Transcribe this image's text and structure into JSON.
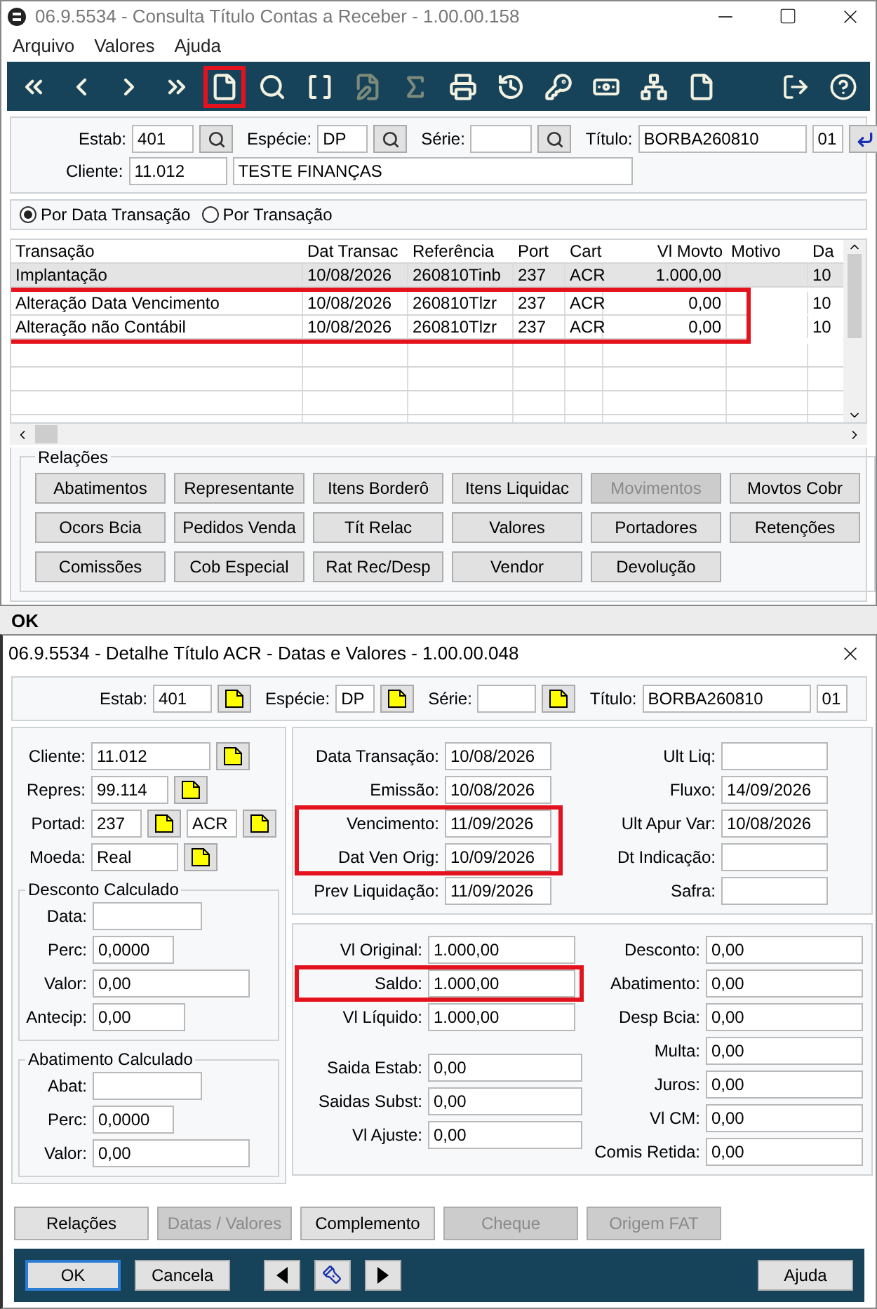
{
  "main_window": {
    "title": "06.9.5534 - Consulta Título Contas a Receber - 1.00.00.158",
    "menu": [
      "Arquivo",
      "Valores",
      "Ajuda"
    ],
    "toolbar": [
      {
        "disabled": false,
        "highlighted": false
      },
      {
        "disabled": false,
        "highlighted": false
      },
      {
        "disabled": false,
        "highlighted": false
      },
      {
        "disabled": false,
        "highlighted": false
      },
      {
        "disabled": false,
        "highlighted": true
      },
      {
        "disabled": false,
        "highlighted": false
      },
      {
        "disabled": false,
        "highlighted": false
      },
      {
        "disabled": true,
        "highlighted": false
      },
      {
        "disabled": true,
        "highlighted": false
      },
      {
        "disabled": false,
        "highlighted": false
      },
      {
        "disabled": false,
        "highlighted": false
      },
      {
        "disabled": false,
        "highlighted": false
      },
      {
        "disabled": false,
        "highlighted": false
      },
      {
        "disabled": false,
        "highlighted": false
      },
      {
        "disabled": false,
        "highlighted": false
      }
    ],
    "header": [
      [
        {
          "label": "Estab:",
          "value": "401",
          "lookup": true
        },
        {
          "label": "Espécie:",
          "value": "DP",
          "lookup": true
        },
        {
          "label": "Série:",
          "lookup": true
        },
        {
          "label": "Título:",
          "value": "BORBA260810",
          "lookup": false
        },
        {
          "value": "01",
          "lookup": false
        }
      ],
      [
        {
          "label": "Cliente:",
          "value": "11.012",
          "lookup": false
        },
        {
          "value": "TESTE FINANÇAS",
          "lookup": false
        }
      ]
    ],
    "radios": [
      {
        "label": "Por Data Transação",
        "selected": true
      },
      {
        "label": "Por Transação",
        "selected": false
      }
    ],
    "table": {
      "columns": [
        "Transação",
        "Dat Transac",
        "Referência",
        "Port",
        "Cart",
        "Vl Movto",
        "Motivo",
        "Da"
      ],
      "rows": [
        {
          "cells": [
            "Implantação",
            "10/08/2026",
            "260810Tinb",
            "237",
            "ACR",
            "1.000,00",
            null,
            "10"
          ],
          "selected": true,
          "highlighted": false
        },
        {
          "cells": [
            "Alteração Data Vencimento",
            "10/08/2026",
            "260810Tlzr",
            "237",
            "ACR",
            "0,00",
            null,
            "10"
          ],
          "selected": false,
          "highlighted": true
        },
        {
          "cells": [
            "Alteração não Contábil",
            "10/08/2026",
            "260810Tlzr",
            "237",
            "ACR",
            "0,00",
            null,
            "10"
          ],
          "selected": false,
          "highlighted": true
        }
      ]
    },
    "relations": {
      "title": "Relações",
      "buttons": [
        {
          "label": "Abatimentos",
          "disabled": false
        },
        {
          "label": "Representante",
          "disabled": false
        },
        {
          "label": "Itens Borderô",
          "disabled": false
        },
        {
          "label": "Itens Liquidac",
          "disabled": false
        },
        {
          "label": "Movimentos",
          "disabled": true
        },
        {
          "label": "Movtos Cobr",
          "disabled": false
        },
        {
          "label": "Ocors Bcia",
          "disabled": false
        },
        {
          "label": "Pedidos Venda",
          "disabled": false
        },
        {
          "label": "Tít  Relac",
          "disabled": false
        },
        {
          "label": "Valores",
          "disabled": false
        },
        {
          "label": "Portadores",
          "disabled": false
        },
        {
          "label": "Retenções",
          "disabled": false
        },
        {
          "label": "Comissões",
          "disabled": false
        },
        {
          "label": "Cob Especial",
          "disabled": false
        },
        {
          "label": "Rat Rec/Desp",
          "disabled": false
        },
        {
          "label": "Vendor",
          "disabled": false
        },
        {
          "label": "Devolução",
          "disabled": false
        }
      ]
    }
  },
  "status": "OK",
  "detail_window": {
    "title": "06.9.5534 - Detalhe Título ACR - Datas e Valores - 1.00.00.048",
    "header": [
      {
        "label": "Estab:",
        "value": "401",
        "lookup": true
      },
      {
        "label": "Espécie:",
        "value": "DP",
        "lookup": true
      },
      {
        "label": "Série:",
        "lookup": true
      },
      {
        "label": "Título:",
        "value": "BORBA260810",
        "lookup": false
      },
      {
        "value": "01",
        "lookup": false
      }
    ],
    "party": [
      {
        "label": "Cliente:",
        "value": "11.012",
        "lookup": true
      },
      {
        "label": "Repres:",
        "value": "99.114",
        "lookup": true
      },
      {
        "label": "Portad:",
        "value": "237",
        "lookup": true,
        "extra": {
          "value": "ACR",
          "lookup": true
        }
      },
      {
        "label": "Moeda:",
        "value": "Real",
        "lookup": true
      }
    ],
    "groups": [
      {
        "title": "Desconto Calculado",
        "fields": [
          {
            "label": "Data:"
          },
          {
            "label": "Perc:",
            "value": "0,0000"
          },
          {
            "label": "Valor:",
            "value": "0,00"
          },
          {
            "label": "Antecip:",
            "value": "0,00"
          }
        ]
      },
      {
        "title": "Abatimento Calculado",
        "fields": [
          {
            "label": "Abat:"
          },
          {
            "label": "Perc:",
            "value": "0,0000"
          },
          {
            "label": "Valor:",
            "value": "0,00"
          }
        ]
      }
    ],
    "dates_left": [
      {
        "label": "Data Transação:",
        "value": "10/08/2026",
        "highlighted": false
      },
      {
        "label": "Emissão:",
        "value": "10/08/2026",
        "highlighted": false
      },
      {
        "label": "Vencimento:",
        "value": "11/09/2026",
        "highlighted": true
      },
      {
        "label": "Dat Ven Orig:",
        "value": "10/09/2026",
        "highlighted": true
      },
      {
        "label": "Prev Liquidação:",
        "value": "11/09/2026",
        "highlighted": false
      }
    ],
    "dates_right": [
      {
        "label": "Ult Liq:",
        "highlighted": false
      },
      {
        "label": "Fluxo:",
        "value": "14/09/2026",
        "highlighted": false
      },
      {
        "label": "Ult Apur Var:",
        "value": "10/08/2026",
        "highlighted": false
      },
      {
        "label": "Dt Indicação:",
        "highlighted": false
      },
      {
        "label": "Safra:",
        "highlighted": false
      }
    ],
    "values_left": [
      {
        "label": "Vl Original:",
        "value": "1.000,00",
        "highlighted": false
      },
      {
        "label": "Saldo:",
        "value": "1.000,00",
        "highlighted": true
      },
      {
        "label": "Vl Líquido:",
        "value": "1.000,00",
        "highlighted": false
      }
    ],
    "values_left2": [
      {
        "label": "Saida Estab:",
        "value": "0,00",
        "highlighted": false
      },
      {
        "label": "Saidas Subst:",
        "value": "0,00",
        "highlighted": false
      },
      {
        "label": "Vl Ajuste:",
        "value": "0,00",
        "highlighted": false
      }
    ],
    "values_right": [
      {
        "label": "Desconto:",
        "value": "0,00",
        "highlighted": false
      },
      {
        "label": "Abatimento:",
        "value": "0,00",
        "highlighted": false
      },
      {
        "label": "Desp Bcia:",
        "value": "0,00",
        "highlighted": false
      },
      {
        "label": "Multa:",
        "value": "0,00",
        "highlighted": false
      },
      {
        "label": "Juros:",
        "value": "0,00",
        "highlighted": false
      },
      {
        "label": "Vl CM:",
        "value": "0,00",
        "highlighted": false
      },
      {
        "label": "Comis Retida:",
        "value": "0,00",
        "highlighted": false
      }
    ],
    "sections": [
      {
        "label": "Relações",
        "disabled": false
      },
      {
        "label": "Datas / Valores",
        "disabled": true
      },
      {
        "label": "Complemento",
        "disabled": false
      },
      {
        "label": "Cheque",
        "disabled": true
      },
      {
        "label": "Origem FAT",
        "disabled": true
      }
    ],
    "footer": {
      "ok": "OK",
      "cancel": "Cancela",
      "help": "Ajuda"
    }
  }
}
